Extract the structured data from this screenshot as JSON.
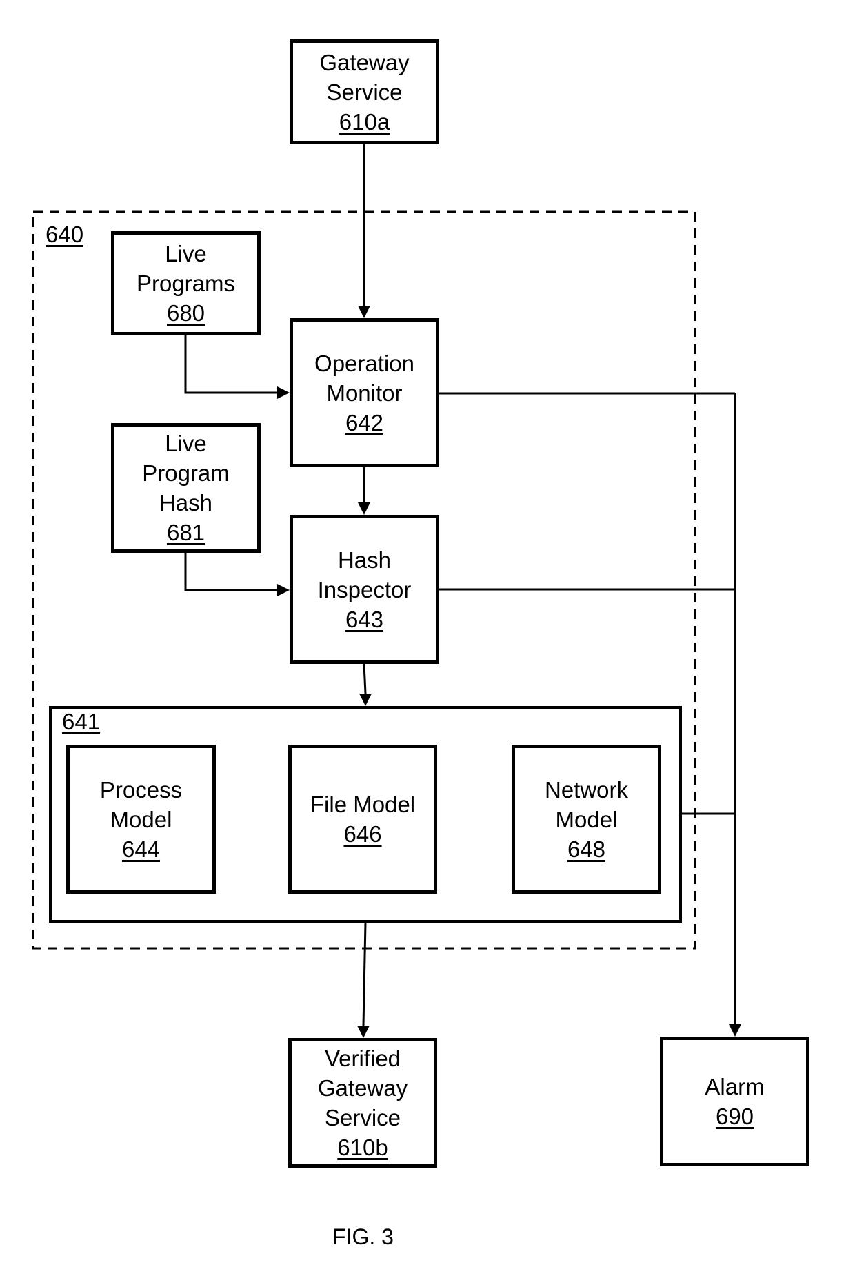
{
  "figure": {
    "caption": "FIG. 3",
    "containers": {
      "system_640": {
        "ref": "640",
        "style": "dashed"
      },
      "models_641": {
        "ref": "641",
        "style": "solid"
      }
    },
    "blocks": {
      "gateway_service": {
        "lines": [
          "Gateway",
          "Service"
        ],
        "ref": "610a"
      },
      "live_programs": {
        "lines": [
          "Live",
          "Programs"
        ],
        "ref": "680"
      },
      "operation_monitor": {
        "lines": [
          "Operation",
          "Monitor"
        ],
        "ref": "642"
      },
      "live_program_hash": {
        "lines": [
          "Live",
          "Program",
          "Hash"
        ],
        "ref": "681"
      },
      "hash_inspector": {
        "lines": [
          "Hash",
          "Inspector"
        ],
        "ref": "643"
      },
      "process_model": {
        "lines": [
          "Process",
          "Model"
        ],
        "ref": "644"
      },
      "file_model": {
        "lines": [
          "File Model"
        ],
        "ref": "646"
      },
      "network_model": {
        "lines": [
          "Network",
          "Model"
        ],
        "ref": "648"
      },
      "verified_gateway_service": {
        "lines": [
          "Verified",
          "Gateway",
          "Service"
        ],
        "ref": "610b"
      },
      "alarm": {
        "lines": [
          "Alarm"
        ],
        "ref": "690"
      }
    },
    "connections": [
      {
        "from": "gateway_service",
        "to": "operation_monitor"
      },
      {
        "from": "live_programs",
        "to": "operation_monitor"
      },
      {
        "from": "operation_monitor",
        "to": "hash_inspector"
      },
      {
        "from": "live_program_hash",
        "to": "hash_inspector"
      },
      {
        "from": "hash_inspector",
        "to": "models_641"
      },
      {
        "from": "models_641",
        "to": "verified_gateway_service"
      },
      {
        "from": "operation_monitor",
        "to": "alarm"
      },
      {
        "from": "hash_inspector",
        "to": "alarm"
      },
      {
        "from": "models_641",
        "to": "alarm"
      }
    ]
  }
}
